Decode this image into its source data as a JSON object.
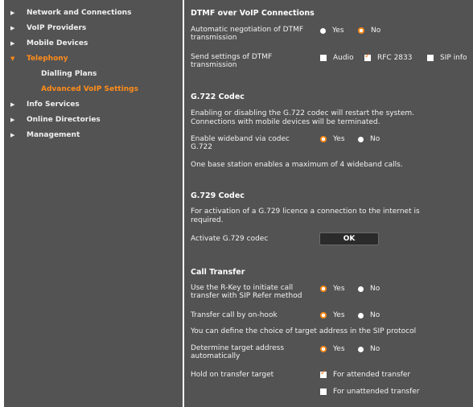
{
  "nav": {
    "items": [
      {
        "label": "Network and Connections",
        "arrow": "▶"
      },
      {
        "label": "VoIP Providers",
        "arrow": "▶"
      },
      {
        "label": "Mobile Devices",
        "arrow": "▶"
      },
      {
        "label": "Telephony",
        "arrow": "▼"
      },
      {
        "label": "Info Services",
        "arrow": "▶"
      },
      {
        "label": "Online Directories",
        "arrow": "▶"
      },
      {
        "label": "Management",
        "arrow": "▶"
      }
    ],
    "subitems": [
      {
        "label": "Dialling Plans"
      },
      {
        "label": "Advanced VoIP Settings"
      }
    ]
  },
  "dtmf": {
    "title": "DTMF over VoIP Connections",
    "auto_label_1": "Automatic negotiation of DTMF",
    "auto_label_2": "transmission",
    "yes": "Yes",
    "no": "No",
    "send_label_1": "Send settings of DTMF",
    "send_label_2": "transmission",
    "audio": "Audio",
    "rfc": "RFC 2833",
    "sipinfo": "SIP info"
  },
  "g722": {
    "title": "G.722 Codec",
    "note_1": "Enabling or disabling the G.722 codec will restart the system.",
    "note_2": "Connections with mobile devices will be terminated.",
    "enable_label_1": "Enable wideband via codec",
    "enable_label_2": "G.722",
    "yes": "Yes",
    "no": "No",
    "max_note": "One base station enables a maximum of 4 wideband calls."
  },
  "g729": {
    "title": "G.729 Codec",
    "note_1": "For activation of a G.729 licence a connection to the internet is",
    "note_2": "required.",
    "activate_label": "Activate G.729 codec",
    "ok": "OK"
  },
  "transfer": {
    "title": "Call Transfer",
    "rkey_label_1": "Use the R-Key to initiate call",
    "rkey_label_2": "transfer with SIP Refer method",
    "onhook_label": "Transfer call by on-hook",
    "define_note": "You can define the choice of target address in the SIP protocol",
    "determine_label_1": "Determine target address",
    "determine_label_2": "automatically",
    "hold_label": "Hold on transfer target",
    "attended": "For attended transfer",
    "unattended": "For unattended transfer",
    "yes": "Yes",
    "no": "No"
  },
  "colors": {
    "panel": "#535353",
    "accent": "#ff8c1a",
    "text": "#f2f2f2"
  }
}
